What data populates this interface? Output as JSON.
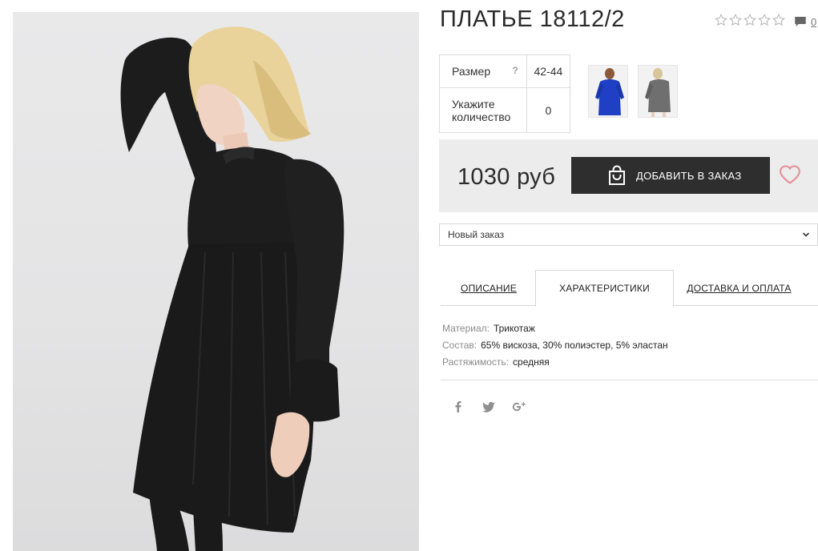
{
  "product": {
    "title": "ПЛАТЬЕ 18112/2",
    "rating_stars": 0,
    "rating_max": 5,
    "comments_count": "0"
  },
  "options": {
    "size_label": "Размер",
    "size_help": "?",
    "size_value": "42-44",
    "qty_label": "Укажите количество",
    "qty_value": "0"
  },
  "thumbnails": [
    {
      "name": "blue-dress-thumbnail",
      "color": "#1f3fc4"
    },
    {
      "name": "grey-dress-thumbnail",
      "color": "#6f6f6f"
    }
  ],
  "buy": {
    "price": "1030 руб",
    "add_button_label": "ДОБАВИТЬ В ЗАКАЗ",
    "favorite_icon": "heart-icon",
    "accent_color": "#e58f97"
  },
  "order": {
    "selected": "Новый заказ"
  },
  "tabs": [
    {
      "label": "ОПИСАНИЕ",
      "active": false
    },
    {
      "label": "ХАРАКТЕРИСТИКИ",
      "active": true
    },
    {
      "label": "ДОСТАВКА И ОПЛАТА",
      "active": false
    }
  ],
  "characteristics": [
    {
      "key": "Материал:",
      "value": "Трикотаж"
    },
    {
      "key": "Состав:",
      "value": "65% вискоза, 30% полиэстер, 5% эластан"
    },
    {
      "key": "Растяжимость:",
      "value": "средняя"
    }
  ],
  "share": [
    "facebook-icon",
    "twitter-icon",
    "google-plus-icon"
  ],
  "colors": {
    "button_bg": "#2e2e2e",
    "box_bg": "#ececec",
    "dress": "#1b1b1b"
  }
}
